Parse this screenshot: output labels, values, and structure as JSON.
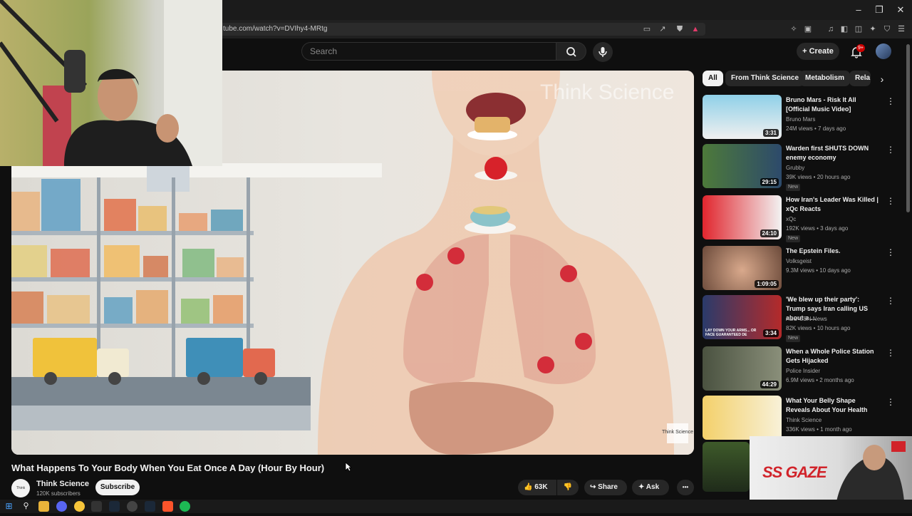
{
  "browser": {
    "url": "tube.com/watch?v=DVIhy4-MRtg",
    "window_controls": [
      "–",
      "❐",
      "✕"
    ]
  },
  "header": {
    "search_placeholder": "Search",
    "create_label": "Create",
    "notification_badge": "9+"
  },
  "video": {
    "title": "What Happens To Your Body When You Eat Once A Day (Hour By Hour)",
    "watermark_top": "Think Science",
    "watermark_corner": "Think Science",
    "channel_name": "Think Science",
    "channel_avatar_text": "Think Science",
    "subscribers": "120K subscribers",
    "subscribe_label": "Subscribe",
    "likes": "63K",
    "share_label": "Share",
    "ask_label": "Ask",
    "more_label": "•••"
  },
  "chips": [
    "All",
    "From Think Science",
    "Metabolism",
    "Rela"
  ],
  "recommendations": [
    {
      "title": "Bruno Mars - Risk It All [Official Music Video]",
      "channel": "Bruno Mars",
      "meta": "24M views • 7 days ago",
      "duration": "3:31",
      "new": ""
    },
    {
      "title": "Warden first SHUTS DOWN enemy economy",
      "channel": "Grubby",
      "meta": "39K views • 20 hours ago",
      "duration": "29:15",
      "new": "New"
    },
    {
      "title": "How Iran's Leader Was Killed | xQc Reacts",
      "channel": "xQc",
      "meta": "192K views • 3 days ago",
      "duration": "24:10",
      "new": "New"
    },
    {
      "title": "The Epstein Files.",
      "channel": "Volksgeist",
      "meta": "9.3M views • 10 days ago",
      "duration": "1:09:05",
      "new": ""
    },
    {
      "title": "'We blew up their party': Trump says Iran calling US about a ...",
      "channel": "ABS-CBN News",
      "meta": "82K views • 10 hours ago",
      "duration": "3:34",
      "new": "New",
      "thumb_caption": "LAY DOWN YOUR ARMS... OR FACE GUARANTEED DE"
    },
    {
      "title": "When a Whole Police Station Gets Hijacked",
      "channel": "Police Insider",
      "meta": "6.9M views • 2 months ago",
      "duration": "44:29",
      "new": ""
    },
    {
      "title": "What Your Belly Shape Reveals About Your Health",
      "channel": "Think Science",
      "meta": "336K views • 1 month ago",
      "duration": "",
      "new": ""
    }
  ],
  "overlay": {
    "brand": "SS GAZE"
  }
}
